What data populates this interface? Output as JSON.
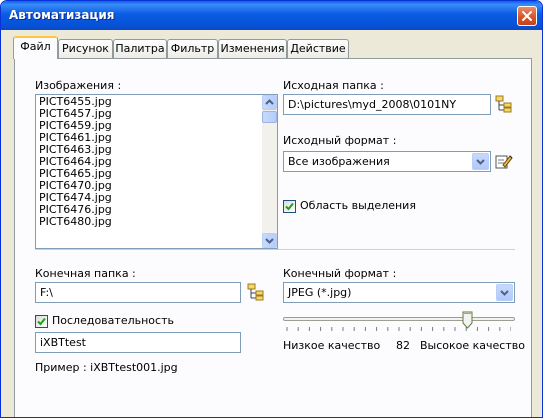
{
  "window": {
    "title": "Автоматизация"
  },
  "tabs": [
    "Файл",
    "Рисунок",
    "Палитра",
    "Фильтр",
    "Изменения",
    "Действие"
  ],
  "images": {
    "label": "Изображения :",
    "files": [
      "PICT6455.jpg",
      "PICT6457.jpg",
      "PICT6459.jpg",
      "PICT6461.jpg",
      "PICT6463.jpg",
      "PICT6464.jpg",
      "PICT6465.jpg",
      "PICT6470.jpg",
      "PICT6474.jpg",
      "PICT6476.jpg",
      "PICT6480.jpg"
    ]
  },
  "source": {
    "folder_label": "Исходная папка :",
    "folder_value": "D:\\pictures\\myd_2008\\0101NY",
    "format_label": "Исходный формат :",
    "format_value": "Все изображения",
    "selection_label": "Область выделения",
    "selection_checked": true
  },
  "destination": {
    "folder_label": "Конечная папка :",
    "folder_value": "F:\\",
    "format_label": "Конечный формат :",
    "format_value": "JPEG (*.jpg)",
    "sequence_label": "Последовательность",
    "sequence_checked": true,
    "prefix_value": "iXBTtest",
    "example_label": "Пример : iXBTtest001.jpg"
  },
  "quality": {
    "low_label": "Низкое качество",
    "value": "82",
    "high_label": "Высокое качество"
  },
  "colors": {
    "titlebar": "#0553da",
    "face": "#ece9d8",
    "accent": "#ffc83c"
  },
  "icons": [
    "close-icon",
    "folder-tree-icon",
    "edit-settings-icon",
    "checkmark-icon",
    "scroll-up-icon",
    "scroll-down-icon",
    "dropdown-arrow-icon"
  ]
}
